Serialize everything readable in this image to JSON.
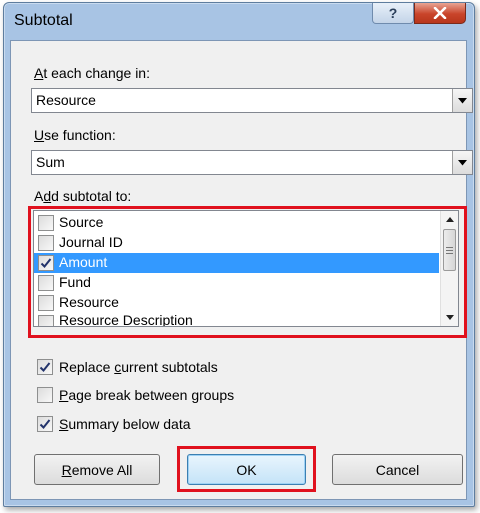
{
  "dialog": {
    "title": "Subtotal",
    "help_icon": "question-mark-icon",
    "close_icon": "close-x-icon"
  },
  "at_each_change": {
    "label_pre": "",
    "label_mnemonic": "A",
    "label_post": "t each change in:",
    "value": "Resource"
  },
  "use_function": {
    "label_pre": "",
    "label_mnemonic": "U",
    "label_post": "se function:",
    "value": "Sum"
  },
  "add_subtotal": {
    "label_pre": "A",
    "label_mnemonic": "d",
    "label_post": "d subtotal to:",
    "items": [
      {
        "label": "Source",
        "checked": false,
        "selected": false
      },
      {
        "label": "Journal ID",
        "checked": false,
        "selected": false
      },
      {
        "label": "Amount",
        "checked": true,
        "selected": true
      },
      {
        "label": "Fund",
        "checked": false,
        "selected": false
      },
      {
        "label": "Resource",
        "checked": false,
        "selected": false
      },
      {
        "label": "Resource Description",
        "checked": false,
        "selected": false
      }
    ]
  },
  "options": {
    "replace": {
      "pre": "Replace ",
      "mnemonic": "c",
      "post": "urrent subtotals",
      "checked": true
    },
    "page_break": {
      "pre": "",
      "mnemonic": "P",
      "post": "age break between groups",
      "checked": false
    },
    "summary": {
      "pre": "",
      "mnemonic": "S",
      "post": "ummary below data",
      "checked": true
    }
  },
  "buttons": {
    "remove_all": {
      "pre": "",
      "mnemonic": "R",
      "post": "emove All"
    },
    "ok": "OK",
    "cancel": "Cancel"
  },
  "colors": {
    "highlight_box": "#e0111e",
    "selection": "#3399ff",
    "titlebar": "#a8c4e4"
  }
}
